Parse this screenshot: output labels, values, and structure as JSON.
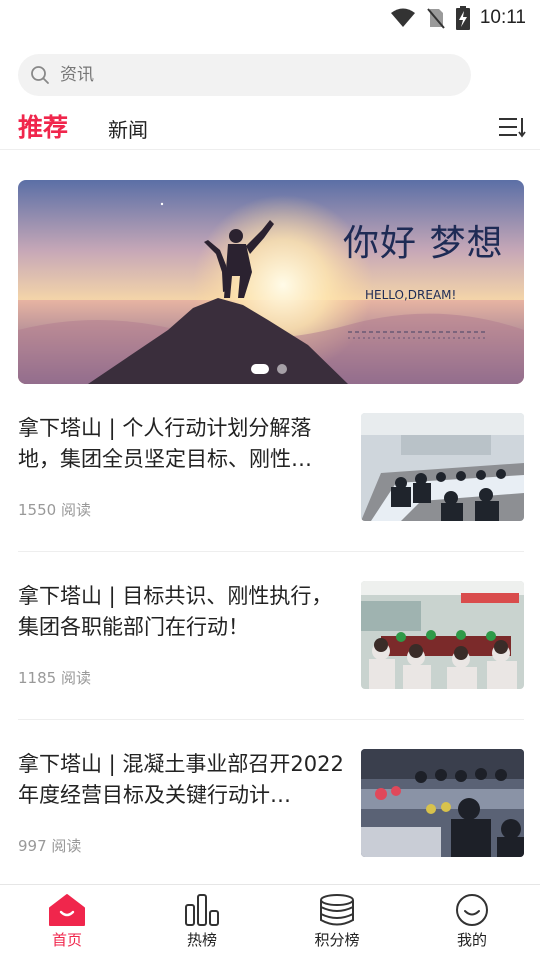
{
  "status_bar": {
    "time": "10:11"
  },
  "search": {
    "placeholder": "资讯"
  },
  "tabs": [
    {
      "label": "推荐",
      "active": true
    },
    {
      "label": "新闻",
      "active": false
    }
  ],
  "banner": {
    "title": "你好 梦想",
    "subtitle": "HELLO,DREAM!",
    "slides": 2,
    "active_slide": 1
  },
  "articles": [
    {
      "title": "拿下塔山 | 个人行动计划分解落地，集团全员坚定目标、刚性…",
      "reads": "1550 阅读"
    },
    {
      "title": "拿下塔山 | 目标共识、刚性执行，集团各职能部门在行动！",
      "reads": "1185 阅读"
    },
    {
      "title": "拿下塔山 | 混凝土事业部召开2022年度经营目标及关键行动计…",
      "reads": "997 阅读"
    }
  ],
  "bottom_nav": [
    {
      "label": "首页",
      "icon": "home-icon",
      "active": true
    },
    {
      "label": "热榜",
      "icon": "bar-chart-icon",
      "active": false
    },
    {
      "label": "积分榜",
      "icon": "coins-icon",
      "active": false
    },
    {
      "label": "我的",
      "icon": "smile-icon",
      "active": false
    }
  ],
  "colors": {
    "accent": "#f0264c",
    "text": "#222222",
    "muted": "#999999"
  }
}
